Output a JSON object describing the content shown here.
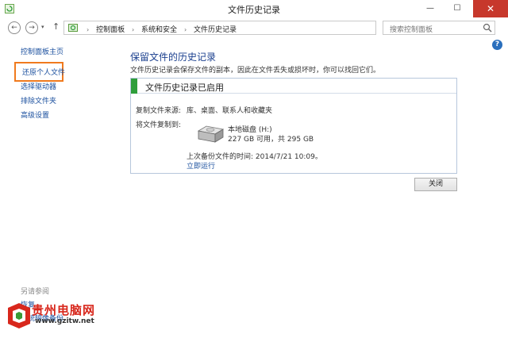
{
  "window": {
    "title": "文件历史记录",
    "minimize_glyph": "—",
    "maximize_glyph": "☐",
    "close_glyph": "✕"
  },
  "navigation": {
    "back_glyph": "←",
    "forward_glyph": "→",
    "dropdown_glyph": "▾",
    "up_glyph": "↑",
    "breadcrumbs": [
      "控制面板",
      "系统和安全",
      "文件历史记录"
    ],
    "breadcrumb_separator": "›",
    "refresh_glyph": "↻",
    "search_placeholder": "搜索控制面板"
  },
  "help_glyph": "?",
  "sidebar": {
    "home": "控制面板主页",
    "restore": "还原个人文件",
    "select_drive": "选择驱动器",
    "exclude_folders": "排除文件夹",
    "advanced": "高级设置",
    "see_also_heading": "另请参阅",
    "see_also_1": "恢复",
    "see_also_2": "系统映像备份"
  },
  "main": {
    "title": "保留文件的历史记录",
    "description": "文件历史记录会保存文件的副本，因此在文件丢失或损坏时，你可以找回它们。",
    "status_title": "文件历史记录已启用",
    "source_label": "复制文件来源:",
    "source_value": "库、桌面、联系人和收藏夹",
    "destination_label": "将文件复制到:",
    "drive_name": "本地磁盘 (H:)",
    "drive_space": "227 GB 可用，共 295 GB",
    "last_backup": "上次备份文件的时间: 2014/7/21 10:09。",
    "run_now": "立即运行",
    "close_button": "关闭"
  },
  "watermark": {
    "text": "贵州电脑网",
    "url": "www.gzitw.net"
  },
  "colors": {
    "link": "#1a4f9e",
    "title": "#1a3f8e",
    "highlight_border": "#f07a1e",
    "status_bar": "#2f9e3a",
    "close_button_red": "#c7382c"
  }
}
